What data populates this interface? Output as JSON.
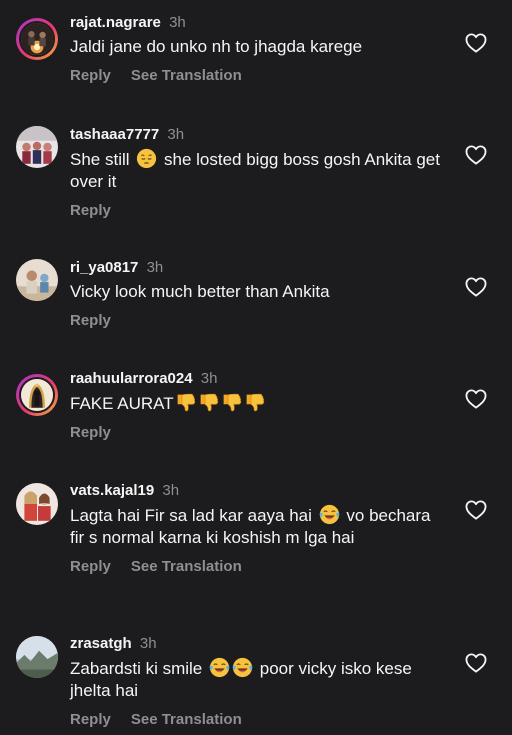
{
  "labels": {
    "reply": "Reply",
    "see_translation": "See Translation"
  },
  "icons": {
    "like": "heart-outline-icon"
  },
  "colors": {
    "background": "#1c1c1e",
    "text": "#f5f5f5",
    "secondary": "#8e8e93",
    "story_ring": "#e43b6d"
  },
  "comments": [
    {
      "username": "rajat.nagrare",
      "time": "3h",
      "text": "Jaldi jane do unko nh to jhagda karege"
    },
    {
      "username": "tashaaa7777",
      "time": "3h",
      "text_a": "She still",
      "emoji_a": "pensive-face",
      "text_b": "she losted bigg boss gosh Ankita get over it"
    },
    {
      "username": "ri_ya0817",
      "time": "3h",
      "text": "Vicky look much better than Ankita"
    },
    {
      "username": "raahuularrora024",
      "time": "3h",
      "text": "FAKE AURAT",
      "emoji": "thumbs-down x4"
    },
    {
      "username": "vats.kajal19",
      "time": "3h",
      "text_a": "Lagta hai Fir sa lad kar aaya hai",
      "emoji_a": "tears-of-joy-face",
      "text_b": "vo bechara fir s normal karna ki koshish m lga hai"
    },
    {
      "username": "zrasatgh",
      "time": "3h",
      "text_a": "Zabardsti ki smile",
      "emoji_a": "tears-of-joy-face x2",
      "text_b": "poor vicky isko kese jhelta hai"
    }
  ]
}
